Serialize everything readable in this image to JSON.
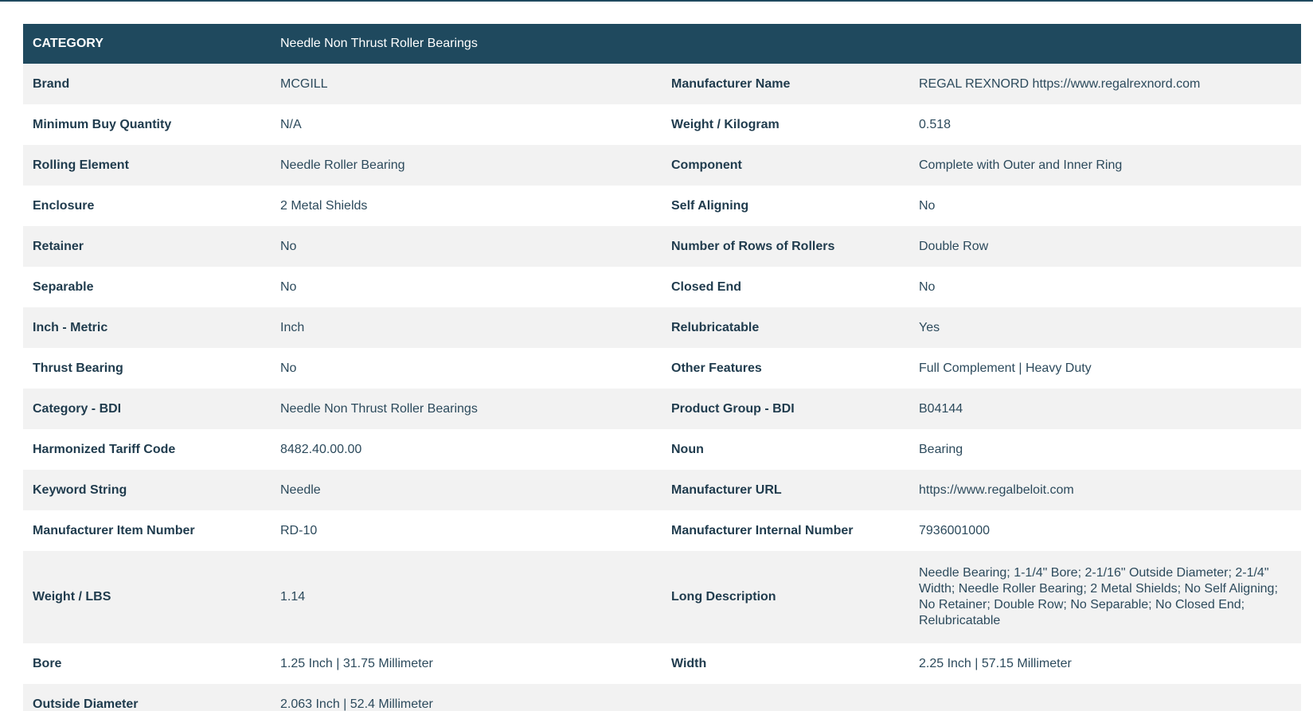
{
  "header": {
    "category_label": "CATEGORY",
    "category_value": "Needle Non Thrust Roller Bearings"
  },
  "rows": [
    {
      "l1": "Brand",
      "v1": "MCGILL",
      "l2": "Manufacturer Name",
      "v2": "REGAL REXNORD https://www.regalrexnord.com"
    },
    {
      "l1": "Minimum Buy Quantity",
      "v1": "N/A",
      "l2": "Weight / Kilogram",
      "v2": "0.518"
    },
    {
      "l1": "Rolling Element",
      "v1": "Needle Roller Bearing",
      "l2": "Component",
      "v2": "Complete with Outer and Inner Ring"
    },
    {
      "l1": "Enclosure",
      "v1": "2 Metal Shields",
      "l2": "Self Aligning",
      "v2": "No"
    },
    {
      "l1": "Retainer",
      "v1": "No",
      "l2": "Number of Rows of Rollers",
      "v2": "Double Row"
    },
    {
      "l1": "Separable",
      "v1": "No",
      "l2": "Closed End",
      "v2": "No"
    },
    {
      "l1": "Inch - Metric",
      "v1": "Inch",
      "l2": "Relubricatable",
      "v2": "Yes"
    },
    {
      "l1": "Thrust Bearing",
      "v1": "No",
      "l2": "Other Features",
      "v2": "Full Complement | Heavy Duty"
    },
    {
      "l1": "Category - BDI",
      "v1": "Needle Non Thrust Roller Bearings",
      "l2": "Product Group - BDI",
      "v2": "B04144"
    },
    {
      "l1": "Harmonized Tariff Code",
      "v1": "8482.40.00.00",
      "l2": "Noun",
      "v2": "Bearing"
    },
    {
      "l1": "Keyword String",
      "v1": "Needle",
      "l2": "Manufacturer URL",
      "v2": "https://www.regalbeloit.com"
    },
    {
      "l1": "Manufacturer Item Number",
      "v1": "RD-10",
      "l2": "Manufacturer Internal Number",
      "v2": "7936001000"
    },
    {
      "l1": "Weight / LBS",
      "v1": "1.14",
      "l2": "Long Description",
      "v2": "Needle Bearing; 1-1/4\" Bore; 2-1/16\" Outside Diameter; 2-1/4\" Width; Needle Roller Bearing; 2 Metal Shields; No Self Aligning; No Retainer; Double Row; No Separable; No Closed End; Relubricatable"
    },
    {
      "l1": "Bore",
      "v1": "1.25 Inch | 31.75 Millimeter",
      "l2": "Width",
      "v2": "2.25 Inch | 57.15 Millimeter"
    },
    {
      "l1": "Outside Diameter",
      "v1": "2.063 Inch | 52.4 Millimeter",
      "l2": "",
      "v2": ""
    }
  ]
}
